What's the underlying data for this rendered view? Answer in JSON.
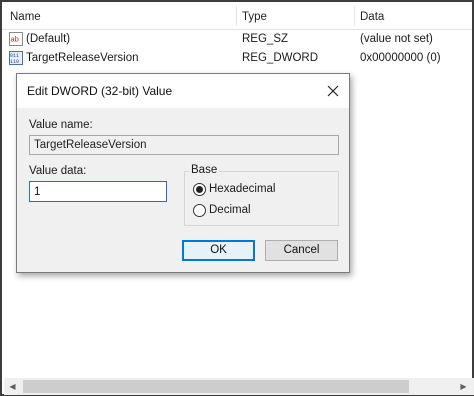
{
  "columns": {
    "name": "Name",
    "type": "Type",
    "data": "Data"
  },
  "rows": [
    {
      "name": "(Default)",
      "type": "REG_SZ",
      "data": "(value not set)",
      "icon": "string-value-icon"
    },
    {
      "name": "TargetReleaseVersion",
      "type": "REG_DWORD",
      "data": "0x00000000 (0)",
      "icon": "binary-value-icon"
    }
  ],
  "dialog": {
    "title": "Edit DWORD (32-bit) Value",
    "value_name_label": "Value name:",
    "value_name": "TargetReleaseVersion",
    "value_data_label": "Value data:",
    "value_data": "1",
    "base_label": "Base",
    "base_options": [
      {
        "label": "Hexadecimal",
        "selected": true
      },
      {
        "label": "Decimal",
        "selected": false
      }
    ],
    "ok_label": "OK",
    "cancel_label": "Cancel"
  },
  "colors": {
    "focus_border": "#0078d7",
    "dialog_bg": "#f0f0f0"
  }
}
